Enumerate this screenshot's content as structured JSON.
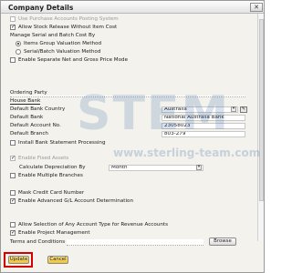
{
  "window": {
    "title": "Company Details",
    "close_glyph": "✕"
  },
  "watermark": {
    "brand": "STEM",
    "url": "www.sterling-team.com"
  },
  "options_top": {
    "use_purchase_posting": "Use Purchase Accounts Posting System",
    "allow_stock_release": "Allow Stock Release Without Item Cost",
    "manage_serial_batch": "Manage Serial and Batch Cost By",
    "items_group_valuation": "Items Group Valuation Method",
    "serial_batch_valuation": "Serial/Batch Valuation Method",
    "enable_separate_net_gross": "Enable Separate Net and Gross Price Mode"
  },
  "banking": {
    "ordering_party_label": "Ordering Party",
    "house_bank_label": "House Bank",
    "default_bank_country_label": "Default Bank Country",
    "default_bank_country_value": "Australia",
    "default_bank_label": "Default Bank",
    "default_bank_value": "National Australia Bank",
    "default_account_label": "Default Account No.",
    "default_account_value": "23058023",
    "default_branch_label": "Default Branch",
    "default_branch_value": "803-279",
    "install_bank_statement": "Install Bank Statement Processing"
  },
  "fixed_assets": {
    "enable_fixed_assets": "Enable Fixed Assets",
    "calc_depreciation_label": "Calculate Depreciation By",
    "calc_depreciation_value": "Month",
    "enable_multiple_branches": "Enable Multiple Branches"
  },
  "misc": {
    "mask_credit_card": "Mask Credit Card Number",
    "enable_advanced_gl": "Enable Advanced G/L Account Determination",
    "allow_selection_revenue": "Allow Selection of Any Account Type for Revenue Accounts",
    "enable_project_management": "Enable Project Management",
    "terms_label": "Terms and Conditions",
    "browse_label": "Browse"
  },
  "footer": {
    "update_label": "Update",
    "cancel_label": "Cancel"
  },
  "colors": {
    "accent_button": "#f2c230",
    "highlight_border": "#d40000"
  }
}
